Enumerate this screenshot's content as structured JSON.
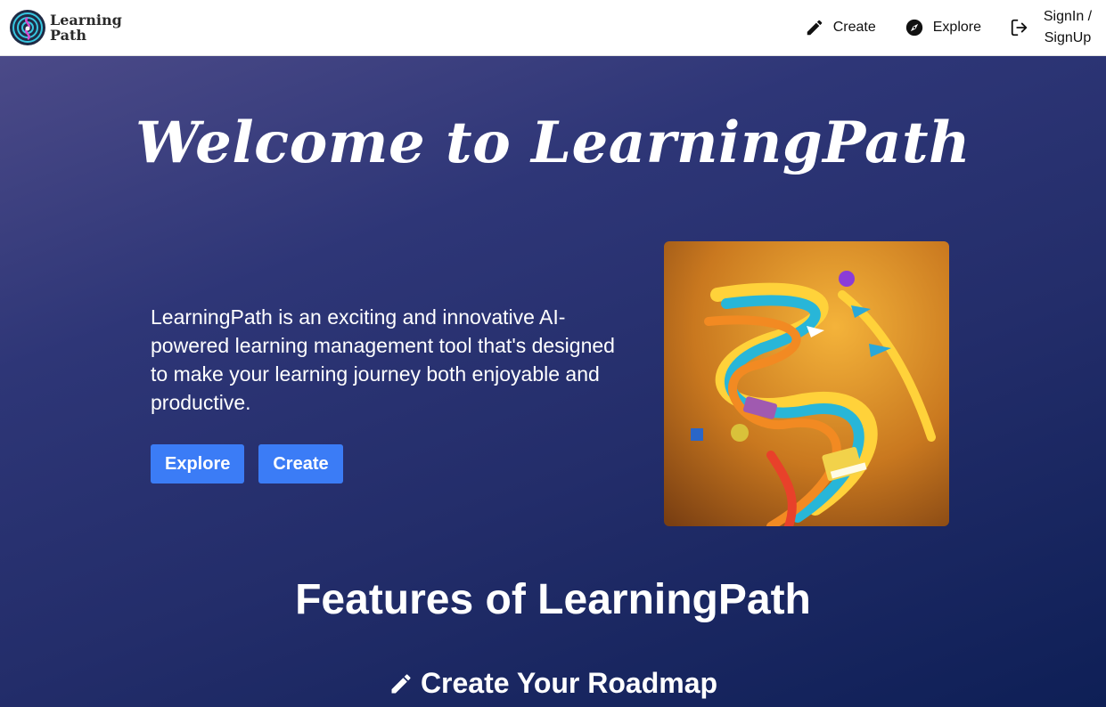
{
  "brand": {
    "name": "Learning\nPath",
    "logo_icon": "brain-target-logo"
  },
  "nav": {
    "items": [
      {
        "label": "Create",
        "icon": "pencil-icon"
      },
      {
        "label": "Explore",
        "icon": "compass-icon"
      },
      {
        "label": "SignIn /\nSignUp",
        "icon": "logout-icon"
      }
    ]
  },
  "hero": {
    "title": "Welcome to LearningPath",
    "description": "LearningPath is an exciting and innovative AI-powered learning management tool that's designed to make your learning journey both enjoyable and productive.",
    "buttons": [
      {
        "label": "Explore"
      },
      {
        "label": "Create"
      }
    ],
    "image_icon": "learning-path-illustration"
  },
  "features": {
    "title": "Features of LearningPath",
    "first_heading": "Create Your Roadmap",
    "first_heading_icon": "pencil-icon"
  },
  "colors": {
    "accent": "#3b7cf6",
    "hero_gradient_start": "#4b4a88",
    "hero_gradient_end": "#0e1f56",
    "navbar_bg": "#ffffff"
  }
}
